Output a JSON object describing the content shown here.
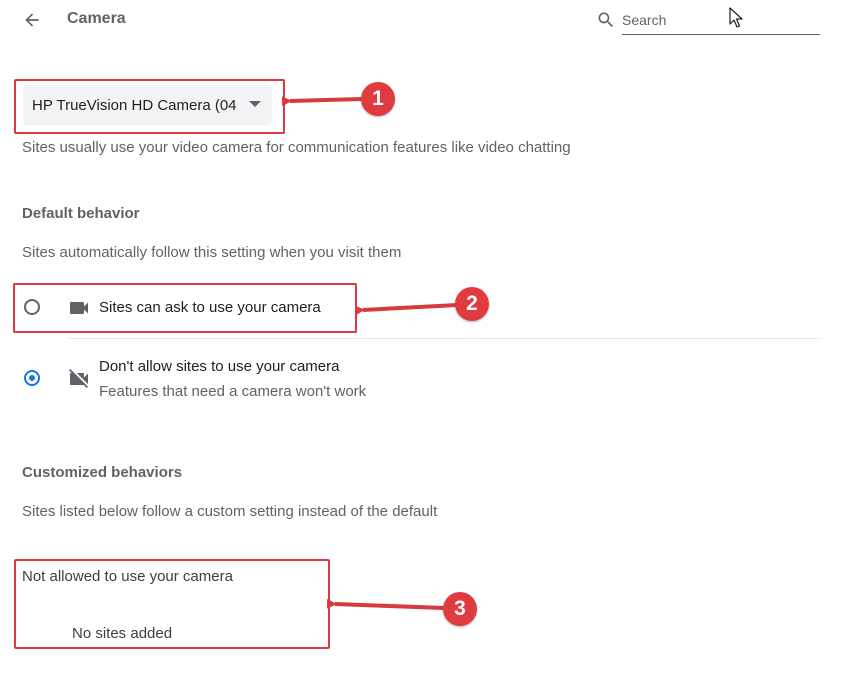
{
  "header": {
    "title": "Camera",
    "search_placeholder": "Search"
  },
  "camera_select": {
    "selected": "HP TrueVision HD Camera (04"
  },
  "camera_description": "Sites usually use your video camera for communication features like video chatting",
  "default_behavior": {
    "heading": "Default behavior",
    "description": "Sites automatically follow this setting when you visit them",
    "options": [
      {
        "label": "Sites can ask to use your camera",
        "sublabel": "",
        "checked": false,
        "icon": "camera-icon"
      },
      {
        "label": "Don't allow sites to use your camera",
        "sublabel": "Features that need a camera won't work",
        "checked": true,
        "icon": "camera-off-icon"
      }
    ]
  },
  "customized_behaviors": {
    "heading": "Customized behaviors",
    "description": "Sites listed below follow a custom setting instead of the default",
    "not_allowed_heading": "Not allowed to use your camera",
    "empty_text": "No sites added"
  },
  "annotations": {
    "badges": [
      "1",
      "2",
      "3"
    ],
    "color": "#e03b3f"
  },
  "colors": {
    "accent": "#1a73e8",
    "text_primary": "#202124",
    "text_secondary": "#5f6368",
    "select_bg": "#f1f3f4"
  }
}
